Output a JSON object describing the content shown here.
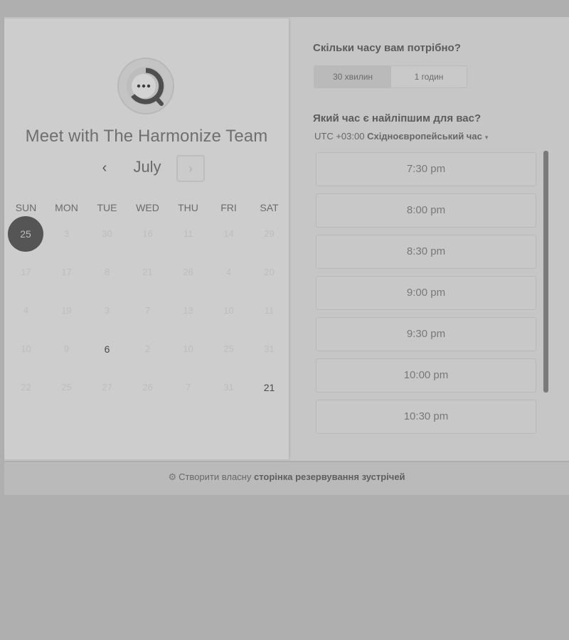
{
  "colors": {
    "background": "#afafaf",
    "panel": "#cdcdcd",
    "selected_day": "#555555",
    "scrollbar": "#7a7a7a"
  },
  "left": {
    "title": "Meet with The Harmonize Team",
    "logo_icon": "chat-bubble-logo",
    "month": "July",
    "prev_icon": "‹",
    "next_icon": "›",
    "weekdays": [
      "SUN",
      "MON",
      "TUE",
      "WED",
      "THU",
      "FRI",
      "SAT"
    ],
    "weeks": [
      [
        {
          "d": "25",
          "s": "selected"
        },
        {
          "d": "3",
          "s": "disabled"
        },
        {
          "d": "30",
          "s": "disabled"
        },
        {
          "d": "16",
          "s": "disabled"
        },
        {
          "d": "11",
          "s": "disabled"
        },
        {
          "d": "14",
          "s": "disabled"
        },
        {
          "d": "29",
          "s": "disabled"
        }
      ],
      [
        {
          "d": "17",
          "s": "disabled"
        },
        {
          "d": "17",
          "s": "disabled"
        },
        {
          "d": "8",
          "s": "disabled"
        },
        {
          "d": "21",
          "s": "disabled"
        },
        {
          "d": "26",
          "s": "disabled"
        },
        {
          "d": "4",
          "s": "disabled"
        },
        {
          "d": "20",
          "s": "disabled"
        }
      ],
      [
        {
          "d": "4",
          "s": "disabled"
        },
        {
          "d": "19",
          "s": "disabled"
        },
        {
          "d": "3",
          "s": "disabled"
        },
        {
          "d": "7",
          "s": "disabled"
        },
        {
          "d": "13",
          "s": "disabled"
        },
        {
          "d": "10",
          "s": "disabled"
        },
        {
          "d": "11",
          "s": "disabled"
        }
      ],
      [
        {
          "d": "10",
          "s": "disabled"
        },
        {
          "d": "9",
          "s": "disabled"
        },
        {
          "d": "6",
          "s": "available"
        },
        {
          "d": "2",
          "s": "disabled"
        },
        {
          "d": "10",
          "s": "disabled"
        },
        {
          "d": "25",
          "s": "disabled"
        },
        {
          "d": "31",
          "s": "disabled"
        }
      ],
      [
        {
          "d": "22",
          "s": "disabled"
        },
        {
          "d": "25",
          "s": "disabled"
        },
        {
          "d": "27",
          "s": "disabled"
        },
        {
          "d": "26",
          "s": "disabled"
        },
        {
          "d": "7",
          "s": "disabled"
        },
        {
          "d": "31",
          "s": "disabled"
        },
        {
          "d": "21",
          "s": "available"
        }
      ]
    ]
  },
  "right": {
    "duration_question": "Скільки часу вам потрібно?",
    "durations": [
      {
        "label": "30 хвилин",
        "active": true
      },
      {
        "label": "1 годин",
        "active": false
      }
    ],
    "time_question": "Який час є найліпшим для вас?",
    "timezone_offset": "UTC +03:00",
    "timezone_name": "Східноєвропейський час",
    "timezone_caret": "▾",
    "time_slots": [
      "7:30 pm",
      "8:00 pm",
      "8:30 pm",
      "9:00 pm",
      "9:30 pm",
      "10:00 pm",
      "10:30 pm"
    ]
  },
  "footer": {
    "icon": "hubspot-sprocket-icon",
    "icon_glyph": "⚙",
    "prefix": "Створити власну",
    "link": "сторінка резервування зустрічей"
  }
}
